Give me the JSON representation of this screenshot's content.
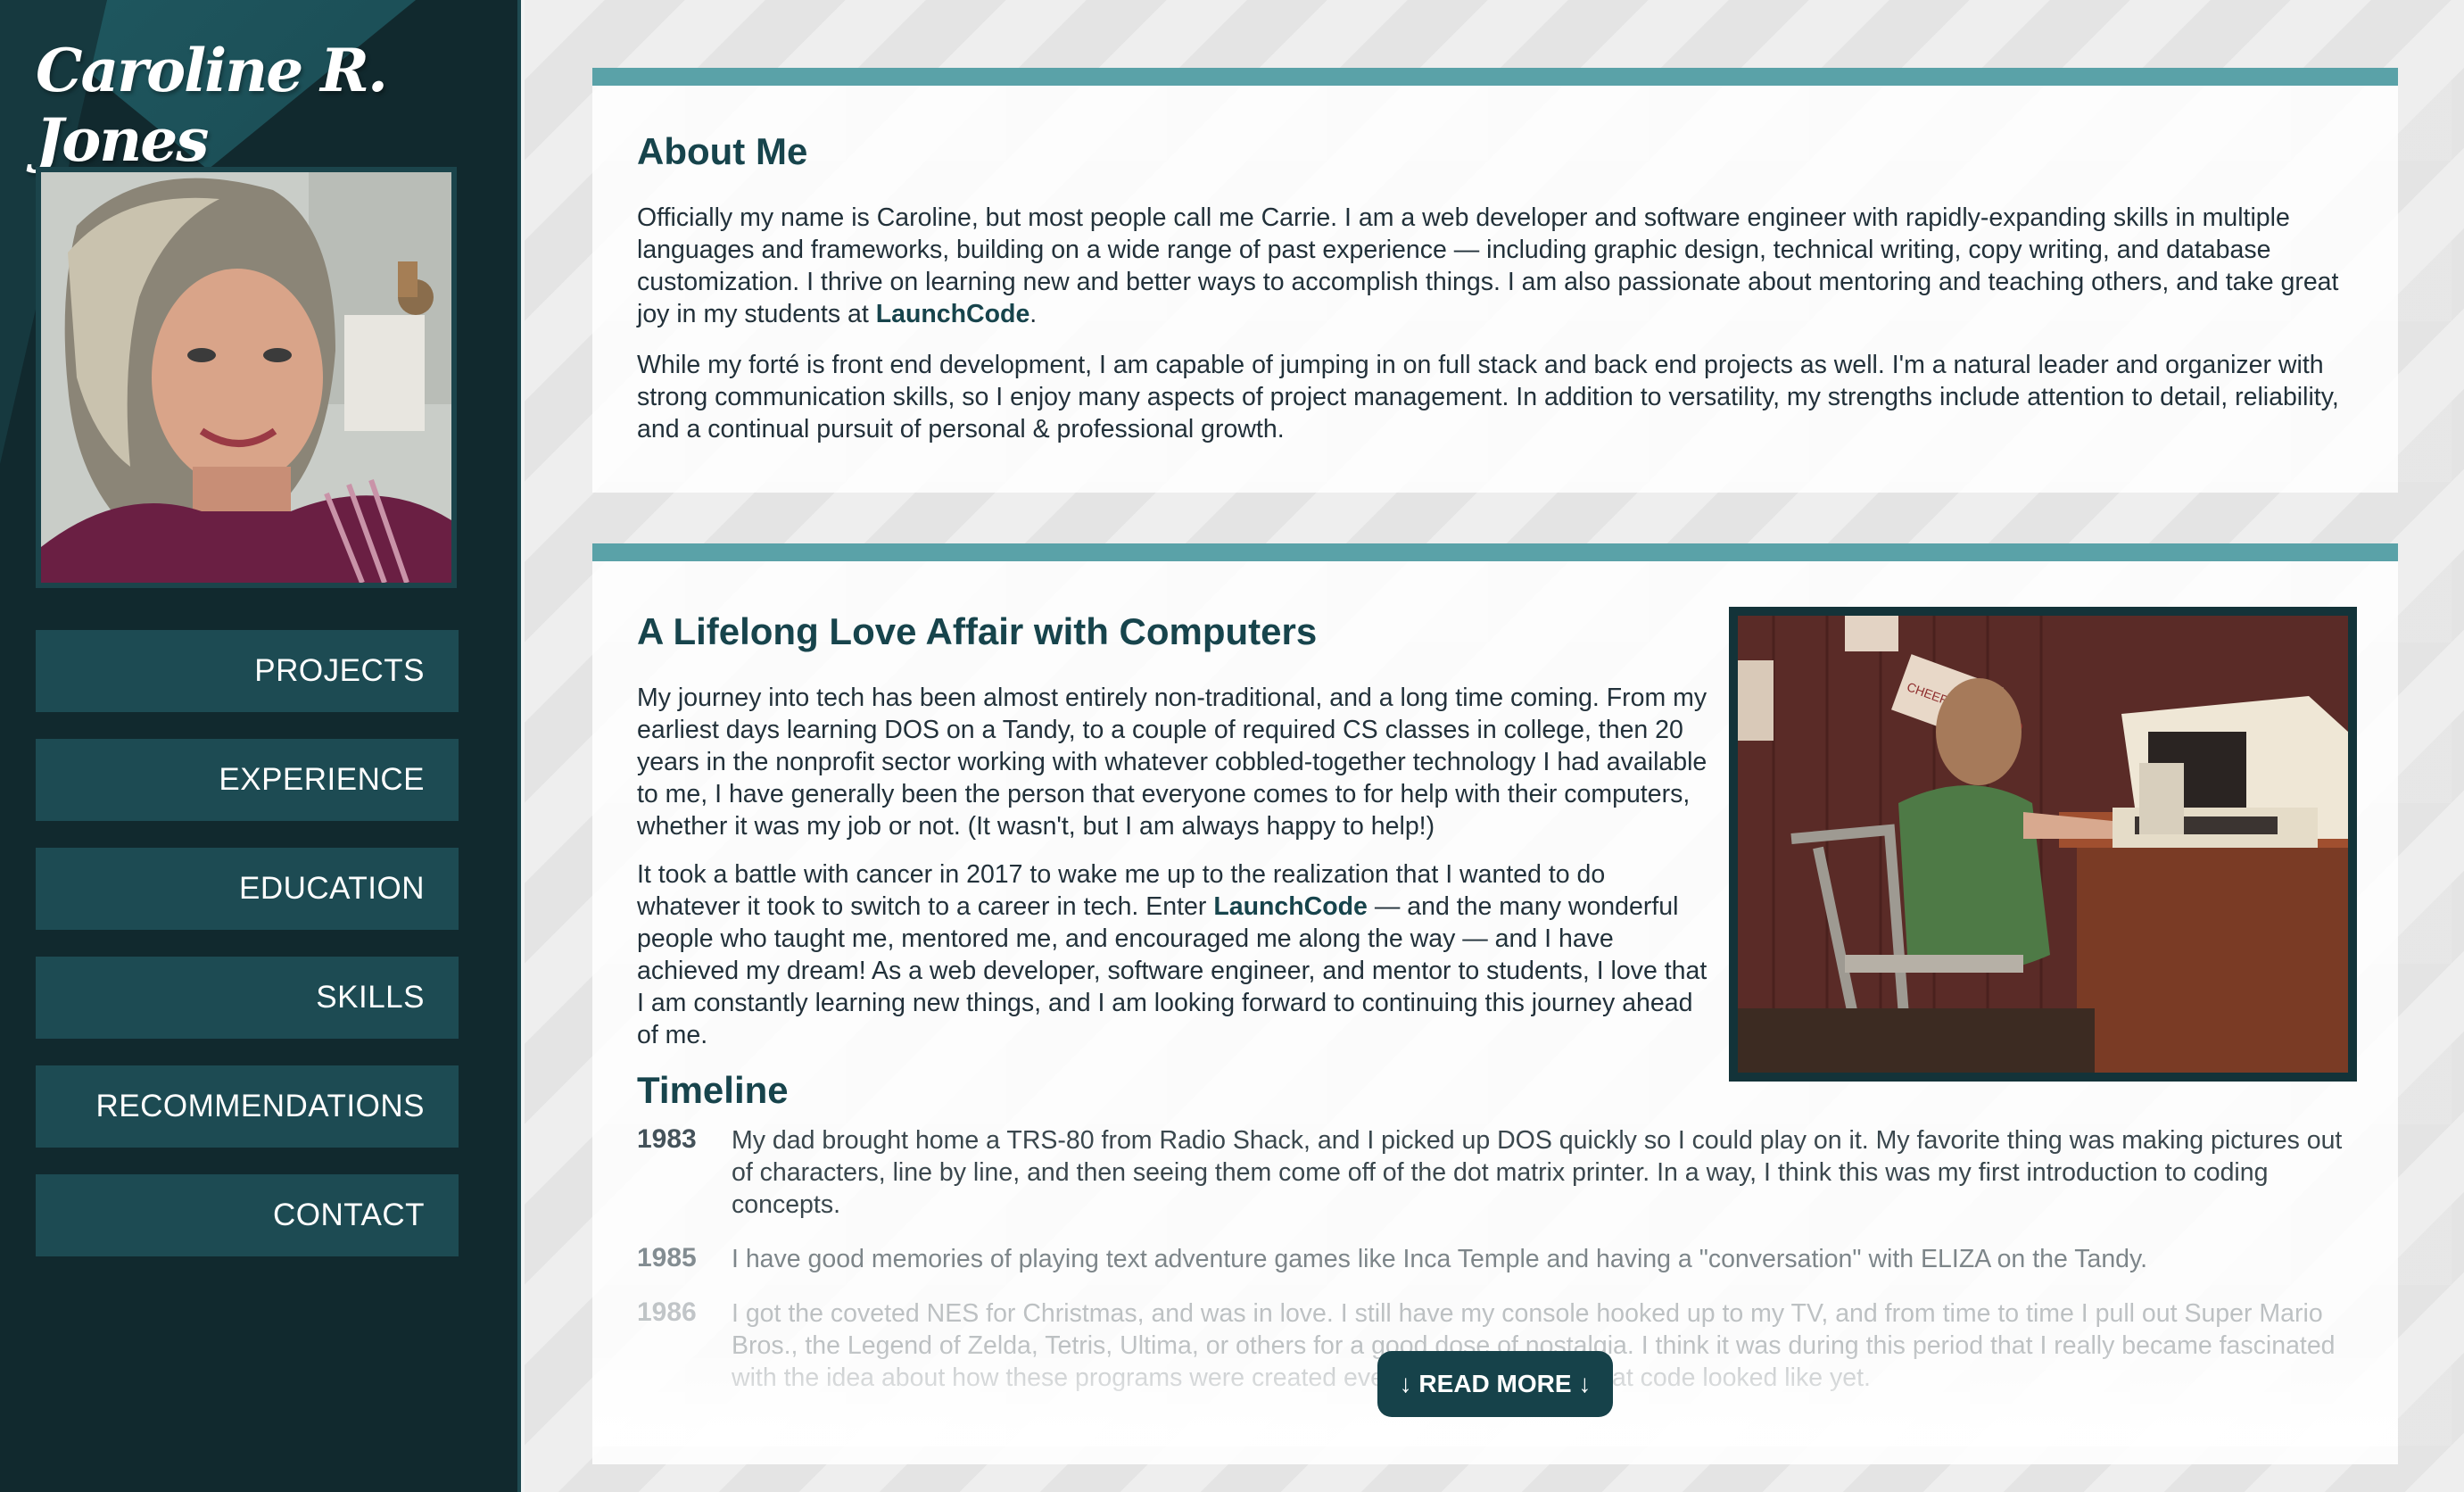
{
  "sidebar": {
    "name": "Caroline R. Jones",
    "photo_alt": "Portrait of Caroline",
    "nav": [
      "PROJECTS",
      "EXPERIENCE",
      "EDUCATION",
      "SKILLS",
      "RECOMMENDATIONS",
      "CONTACT"
    ]
  },
  "about": {
    "title": "About Me",
    "p1_before": "Officially my name is Caroline, but most people call me Carrie. I am a web developer and software engineer with rapidly-expanding skills in multiple languages and frameworks, building on a wide range of past experience — including graphic design, technical writing, copy writing, and database customization. I thrive on learning new and better ways to accomplish things. I am also passionate about mentoring and teaching others, and take great joy in my students at ",
    "p1_link": "LaunchCode",
    "p1_after": ".",
    "p2": "While my forté is front end development, I am capable of jumping in on full stack and back end projects as well. I'm a natural leader and organizer with strong communication skills, so I enjoy many aspects of project management. In addition to versatility, my strengths include attention to detail, reliability, and a continual pursuit of personal & professional growth."
  },
  "love": {
    "title": "A Lifelong Love Affair with Computers",
    "p1": "My journey into tech has been almost entirely non-traditional, and a long time coming. From my earliest days learning DOS on a Tandy, to a couple of required CS classes in college, then 20 years in the nonprofit sector working with whatever cobbled-together technology I had available to me, I have generally been the person that everyone comes to for help with their computers, whether it was my job or not. (It wasn't, but I am always happy to help!)",
    "p2_before": "It took a battle with cancer in 2017 to wake me up to the realization that I wanted to do whatever it took to switch to a career in tech. Enter ",
    "p2_link": "LaunchCode",
    "p2_after": " — and the many wonderful people who taught me, mentored me, and encouraged me along the way — and I have achieved my dream! As a web developer, software engineer, and mentor to students, I love that I am constantly learning new things, and I am looking forward to continuing this journey ahead of me.",
    "sign_text": "CHEER UP BE DEAD"
  },
  "timeline": {
    "title": "Timeline",
    "items": [
      {
        "year": "1983",
        "text": "My dad brought home a TRS-80 from Radio Shack, and I picked up DOS quickly so I could play on it. My favorite thing was making pictures out of characters, line by line, and then seeing them come off of the dot matrix printer. In a way, I think this was my first introduction to coding concepts."
      },
      {
        "year": "1985",
        "text": "I have good memories of playing text adventure games like Inca Temple and having a \"conversation\" with ELIZA on the Tandy."
      },
      {
        "year": "1986",
        "text": "I got the coveted NES for Christmas, and was in love. I still have my console hooked up to my TV, and from time to time I pull out Super Mario Bros., the Legend of Zelda, Tetris, Ultima, or others for a good dose of nostalgia. I think it was during this period that I really became fascinated with the idea about how these programs were created every now and then, what code looked like yet."
      }
    ],
    "read_more": "↓ READ MORE ↓"
  },
  "colors": {
    "sidebar_bg": "#11292e",
    "nav_bg": "#1d4b53",
    "accent_bar": "#5aa2a8",
    "heading": "#17444c"
  }
}
